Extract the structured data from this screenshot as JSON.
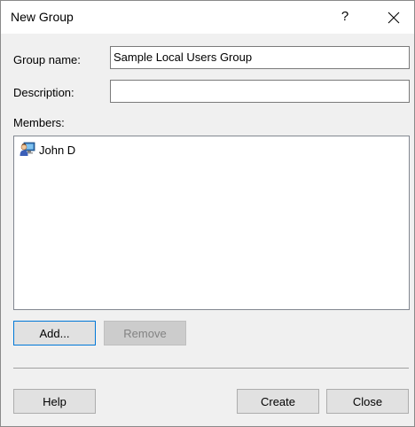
{
  "window": {
    "title": "New Group",
    "help_glyph": "?",
    "close_icon": "close-icon"
  },
  "form": {
    "group_name_label": "Group name:",
    "group_name_value": "Sample Local Users Group",
    "description_label": "Description:",
    "description_value": "",
    "members_label": "Members:"
  },
  "members": [
    {
      "name": "John D",
      "icon": "user-icon"
    }
  ],
  "buttons": {
    "add": "Add...",
    "remove": "Remove",
    "help": "Help",
    "create": "Create",
    "close": "Close"
  }
}
